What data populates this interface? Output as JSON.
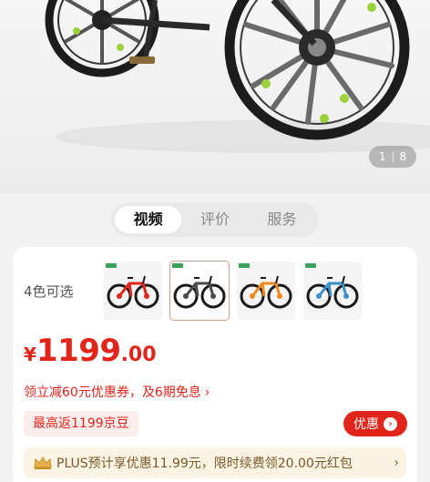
{
  "gallery": {
    "page_current": "1",
    "page_total": "8"
  },
  "tabs": [
    {
      "label": "视频",
      "active": true
    },
    {
      "label": "评价",
      "active": false
    },
    {
      "label": "服务",
      "active": false
    }
  ],
  "variants": {
    "label": "4色可选",
    "items": [
      {
        "frame_color": "#e1251b",
        "selected": false
      },
      {
        "frame_color": "#4a4a4a",
        "selected": true
      },
      {
        "frame_color": "#f08a1c",
        "selected": false
      },
      {
        "frame_color": "#3c8fc9",
        "selected": false
      }
    ]
  },
  "price": {
    "symbol": "¥",
    "integer": "1199",
    "decimal": ".00"
  },
  "coupon": {
    "text": "领立减60元优惠券，及6期免息",
    "arrow": "›"
  },
  "beans_badge": "最高返1199京豆",
  "deal_button": {
    "label": "优惠",
    "icon": "›"
  },
  "plus": {
    "icon": "crown-icon",
    "text": "PLUS预计享优惠11.99元，限时续费领20.00元红包",
    "arrow": "›"
  },
  "colors": {
    "accent_red": "#e1251b",
    "plus_gold": "#7a5a2a"
  }
}
